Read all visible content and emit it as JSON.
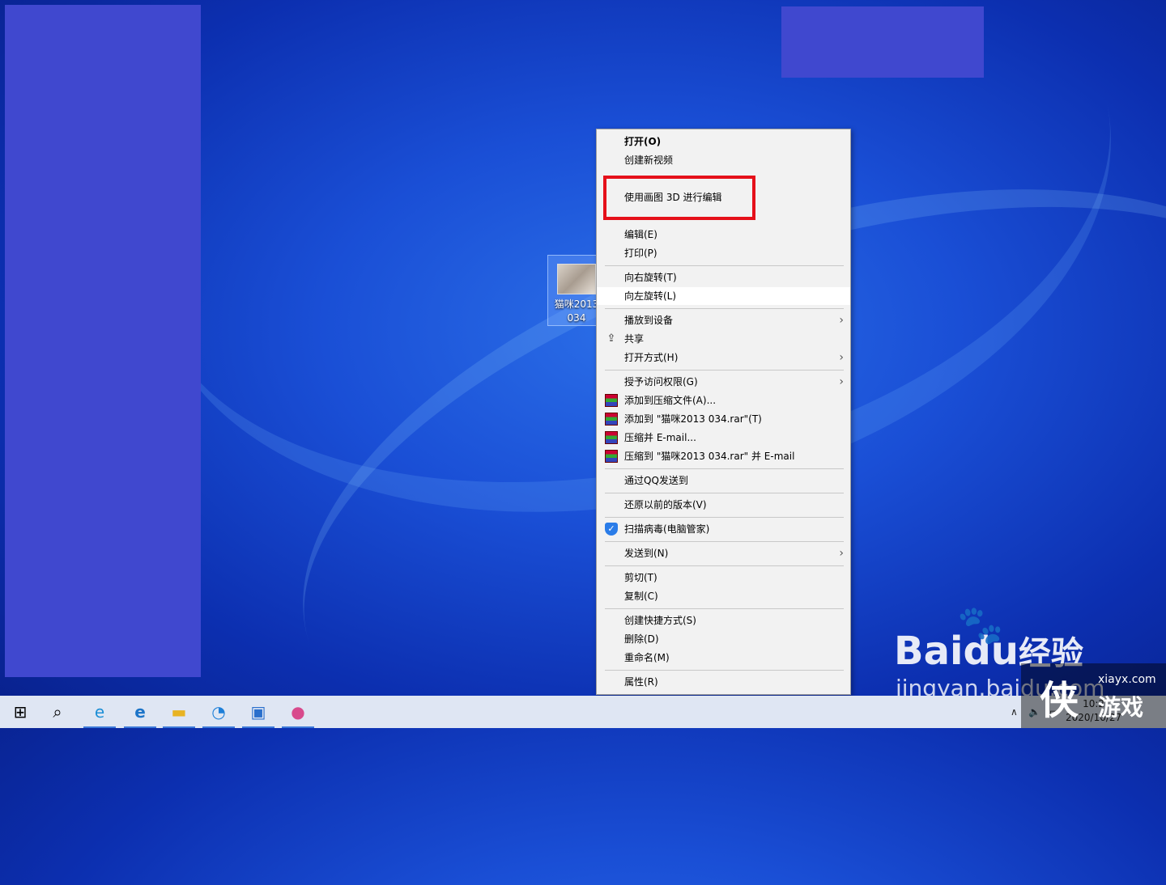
{
  "desktop": {
    "file_icon_label_line1": "猫咪2013",
    "file_icon_label_line2": "034"
  },
  "context_menu": {
    "items": [
      {
        "label": "打开(O)",
        "bold": true
      },
      {
        "label": "创建新视频"
      },
      {
        "label": "使用画图 3D 进行编辑"
      },
      {
        "label": "编辑(E)"
      },
      {
        "label": "打印(P)"
      },
      {
        "label": "向右旋转(T)"
      },
      {
        "label": "向左旋转(L)",
        "hovered": true
      },
      {
        "label": "播放到设备",
        "submenu": true
      },
      {
        "label": "共享",
        "icon": "share-icon"
      },
      {
        "label": "打开方式(H)",
        "submenu": true
      },
      {
        "label": "授予访问权限(G)",
        "submenu": true
      },
      {
        "label": "添加到压缩文件(A)...",
        "icon": "winrar-icon"
      },
      {
        "label": "添加到 \"猫咪2013 034.rar\"(T)",
        "icon": "winrar-icon"
      },
      {
        "label": "压缩并 E-mail...",
        "icon": "winrar-icon"
      },
      {
        "label": "压缩到 \"猫咪2013 034.rar\" 并 E-mail",
        "icon": "winrar-icon"
      },
      {
        "label": "通过QQ发送到"
      },
      {
        "label": "还原以前的版本(V)"
      },
      {
        "label": "扫描病毒(电脑管家)",
        "icon": "pc-manager-shield-icon"
      },
      {
        "label": "发送到(N)",
        "submenu": true
      },
      {
        "label": "剪切(T)"
      },
      {
        "label": "复制(C)"
      },
      {
        "label": "创建快捷方式(S)"
      },
      {
        "label": "删除(D)"
      },
      {
        "label": "重命名(M)"
      },
      {
        "label": "属性(R)"
      }
    ],
    "highlight_color": "#e5101a"
  },
  "taskbar": {
    "apps": [
      "windows-start-icon",
      "search-icon",
      "internet-explorer-icon",
      "edge-icon",
      "file-explorer-icon",
      "photos-icon",
      "photo-viewer-icon",
      "paint3d-icon"
    ],
    "tray_caret": "∧",
    "clock_time": "10:2",
    "clock_date": "2020/10/27"
  },
  "watermarks": {
    "baidu": "Bai",
    "baidu_du": "du",
    "baidu_jingyan": "经验",
    "baidu_sub": "jingyan.baidu.com",
    "xiayx_site": "xiayx.com",
    "xiayx_big": "侠",
    "xiayx_game": "游戏"
  }
}
